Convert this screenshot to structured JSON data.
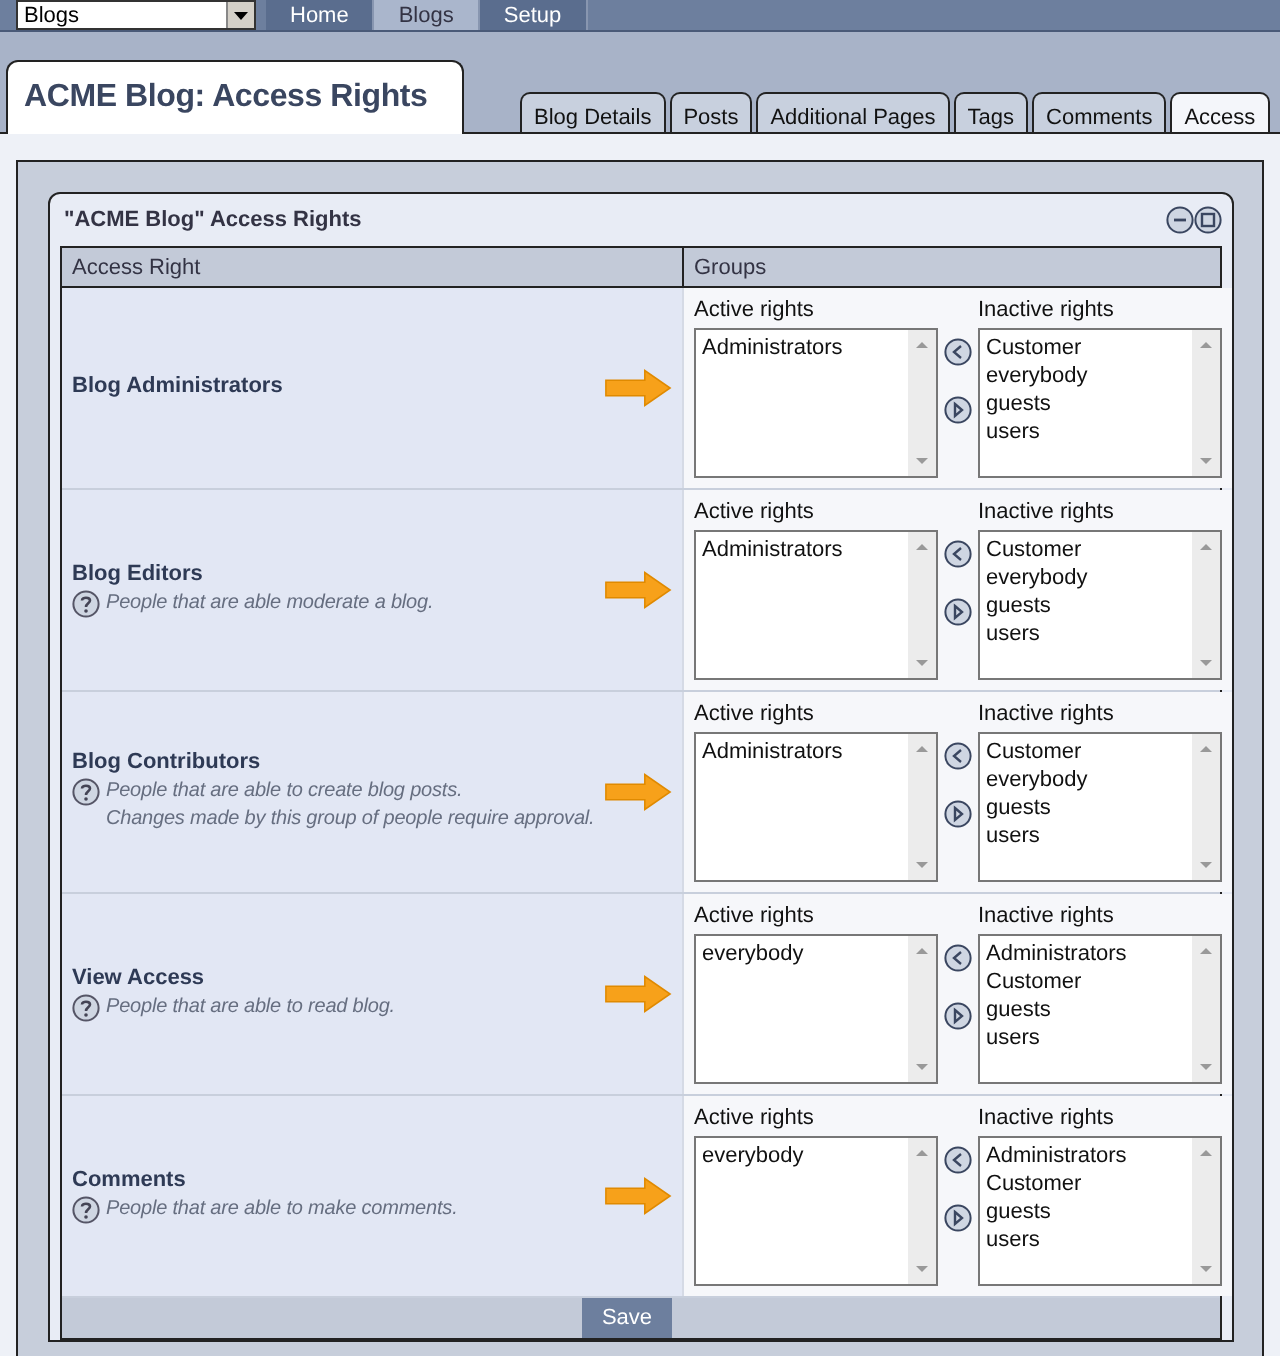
{
  "top_bar": {
    "section_select": "Blogs",
    "nav": [
      {
        "label": "Home",
        "selected": false
      },
      {
        "label": "Blogs",
        "selected": true
      },
      {
        "label": "Setup",
        "selected": false
      }
    ]
  },
  "page_title": "ACME Blog: Access Rights",
  "tabs": [
    {
      "label": "Blog Details",
      "selected": false
    },
    {
      "label": "Posts",
      "selected": false
    },
    {
      "label": "Additional Pages",
      "selected": false
    },
    {
      "label": "Tags",
      "selected": false
    },
    {
      "label": "Comments",
      "selected": false
    },
    {
      "label": "Access",
      "selected": true
    }
  ],
  "panel": {
    "title": "\"ACME Blog\" Access Rights",
    "columns": [
      "Access Right",
      "Groups"
    ],
    "rows": [
      {
        "name": "Blog Administrators",
        "description": [],
        "active_label": "Active rights",
        "active": [
          "Administrators"
        ],
        "inactive_label": "Inactive rights",
        "inactive": [
          "Customer",
          "everybody",
          "guests",
          "users"
        ]
      },
      {
        "name": "Blog Editors",
        "description": [
          "People that are able moderate a blog."
        ],
        "active_label": "Active rights",
        "active": [
          "Administrators"
        ],
        "inactive_label": "Inactive rights",
        "inactive": [
          "Customer",
          "everybody",
          "guests",
          "users"
        ]
      },
      {
        "name": "Blog Contributors",
        "description": [
          "People that are able to create blog posts.",
          "Changes made by this group of people require approval."
        ],
        "active_label": "Active rights",
        "active": [
          "Administrators"
        ],
        "inactive_label": "Inactive rights",
        "inactive": [
          "Customer",
          "everybody",
          "guests",
          "users"
        ]
      },
      {
        "name": "View Access",
        "description": [
          "People that are able to read blog."
        ],
        "active_label": "Active rights",
        "active": [
          "everybody"
        ],
        "inactive_label": "Inactive rights",
        "inactive": [
          "Administrators",
          "Customer",
          "guests",
          "users"
        ]
      },
      {
        "name": "Comments",
        "description": [
          "People that are able to make comments."
        ],
        "active_label": "Active rights",
        "active": [
          "everybody"
        ],
        "inactive_label": "Inactive rights",
        "inactive": [
          "Administrators",
          "Customer",
          "guests",
          "users"
        ]
      }
    ],
    "save_button": "Save"
  }
}
